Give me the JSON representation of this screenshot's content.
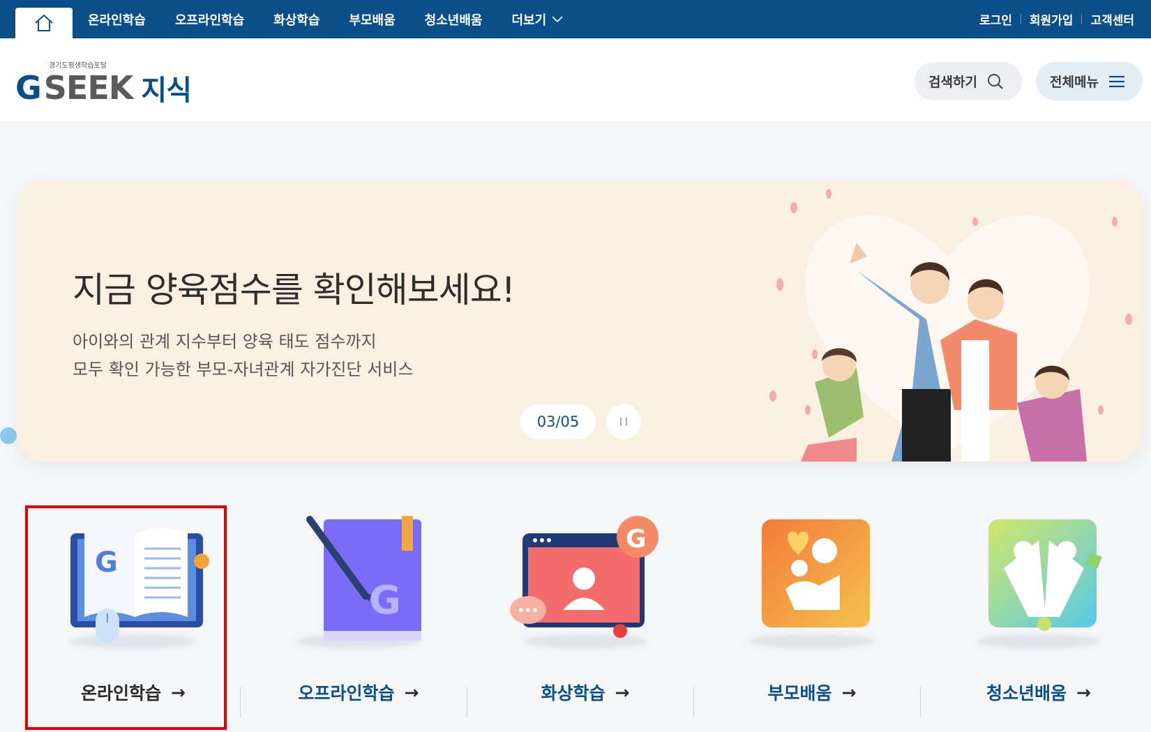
{
  "topnav": {
    "home_icon": "home-icon",
    "items": [
      "온라인학습",
      "오프라인학습",
      "화상학습",
      "부모배움",
      "청소년배움",
      "더보기"
    ],
    "more_icon": "chevron-down-icon",
    "util_links": [
      "로그인",
      "회원가입",
      "고객센터"
    ]
  },
  "header": {
    "logo_sub": "경기도평생학습포털",
    "logo_g": "G",
    "logo_seek": "SEEK",
    "logo_kor": "지식",
    "search_label": "검색하기",
    "search_icon": "search-icon",
    "menu_label": "전체메뉴",
    "menu_icon": "hamburger-icon"
  },
  "banner": {
    "title": "지금 양육점수를 확인해보세요!",
    "desc_line1": "아이와의 관계 지수부터 양육 태도 점수까지",
    "desc_line2": "모두 확인 가능한 부모-자녀관계 자가진단 서비스",
    "pager": "03/05",
    "pause_icon": "pause-icon",
    "bg_color": "#faf0e1"
  },
  "categories": [
    {
      "label": "온라인학습",
      "icon": "online-learning-icon",
      "arrow": "→",
      "selected": true
    },
    {
      "label": "오프라인학습",
      "icon": "offline-learning-icon",
      "arrow": "→"
    },
    {
      "label": "화상학습",
      "icon": "video-learning-icon",
      "arrow": "→"
    },
    {
      "label": "부모배움",
      "icon": "parent-learning-icon",
      "arrow": "→"
    },
    {
      "label": "청소년배움",
      "icon": "youth-learning-icon",
      "arrow": "→"
    }
  ],
  "colors": {
    "brand": "#0a4f8a",
    "highlight": "#e60000"
  }
}
